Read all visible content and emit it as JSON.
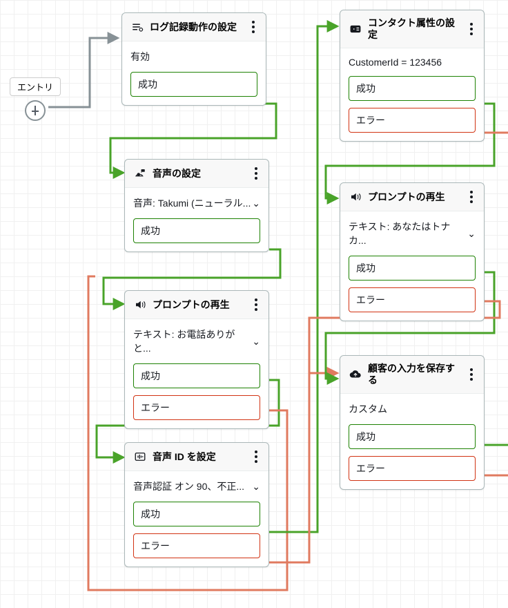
{
  "entry": {
    "label": "エントリ"
  },
  "nodes": {
    "log": {
      "title": "ログ記録動作の設定",
      "body": "有効",
      "outlets": {
        "success": "成功"
      }
    },
    "voice": {
      "title": "音声の設定",
      "body": "音声: Takumi (ニューラル...",
      "outlets": {
        "success": "成功"
      }
    },
    "prompt1": {
      "title": "プロンプトの再生",
      "body": "テキスト: お電話ありがと...",
      "outlets": {
        "success": "成功",
        "error": "エラー"
      }
    },
    "voiceId": {
      "title": "音声 ID を設定",
      "body": "音声認証 オン 90、不正...",
      "outlets": {
        "success": "成功",
        "error": "エラー"
      }
    },
    "contact": {
      "title": "コンタクト属性の設定",
      "body": "CustomerId = 123456",
      "outlets": {
        "success": "成功",
        "error": "エラー"
      }
    },
    "prompt2": {
      "title": "プロンプトの再生",
      "body": "テキスト: あなたはトナカ...",
      "outlets": {
        "success": "成功",
        "error": "エラー"
      }
    },
    "store": {
      "title": "顧客の入力を保存する",
      "body": "カスタム",
      "outlets": {
        "success": "成功",
        "error": "エラー"
      }
    }
  },
  "colors": {
    "success": "#1d8102",
    "error": "#d13212",
    "neutral": "#879196"
  }
}
